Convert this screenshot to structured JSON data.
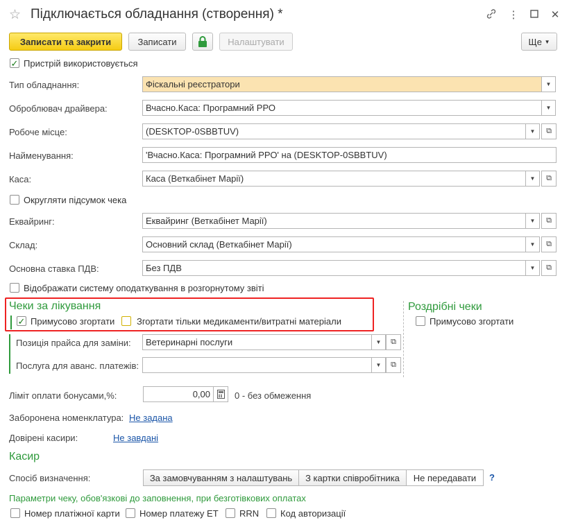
{
  "window": {
    "title": "Підключається обладнання (створення) *",
    "star_icon": "star-icon",
    "link_icon": "link-icon",
    "more_icon": "more-vert-icon",
    "maximize_icon": "maximize-icon",
    "close_icon": "close-icon"
  },
  "toolbar": {
    "save_close_label": "Записати та закрити",
    "save_label": "Записати",
    "lock_icon": "lock-icon",
    "settings_label": "Налаштувати",
    "more_label": "Ще"
  },
  "device_used": {
    "label": "Пристрій використовується",
    "checked": true
  },
  "fields": {
    "equipment_type": {
      "label": "Тип обладнання:",
      "value": "Фіскальні реєстратори"
    },
    "driver_handler": {
      "label": "Оброблювач драйвера:",
      "value": "Вчасно.Каса: Програмний РРО"
    },
    "workplace": {
      "label": "Робоче місце:",
      "value": "(DESKTOP-0SBBTUV)"
    },
    "name": {
      "label": "Найменування:",
      "value": "'Вчасно.Каса: Програмний РРО' на (DESKTOP-0SBBTUV)"
    },
    "cash_desk": {
      "label": "Каса:",
      "value": "Каса (Веткабінет Марії)"
    },
    "acquiring": {
      "label": "Еквайринг:",
      "value": "Еквайринг (Веткабінет Марії)"
    },
    "warehouse": {
      "label": "Склад:",
      "value": "Основний склад (Веткабінет Марії)"
    },
    "vat_rate": {
      "label": "Основна ставка ПДВ:",
      "value": "Без ПДВ"
    }
  },
  "round_total": {
    "label": "Округляти підсумок чека",
    "checked": false
  },
  "show_tax_system": {
    "label": "Відображати систему оподаткування в розгорнутому звіті",
    "checked": false
  },
  "treatment_receipts": {
    "title": "Чеки за лікування",
    "force_collapse": {
      "label": "Примусово згортати",
      "checked": true
    },
    "collapse_only_meds": {
      "label": "Згортати тільки медикаменти/витратні матеріали",
      "checked": false
    },
    "price_position": {
      "label": "Позиція прайса для заміни:",
      "value": "Ветеринарні послуги"
    },
    "advance_service": {
      "label": "Послуга для аванс. платежів:",
      "value": ""
    }
  },
  "retail_receipts": {
    "title": "Роздрібні чеки",
    "force_collapse": {
      "label": "Примусово згортати",
      "checked": false
    }
  },
  "bonus_limit": {
    "label": "Ліміт оплати бонусами,%:",
    "value": "0,00",
    "hint": "0 - без обмеження",
    "calc_icon": "calculator-icon"
  },
  "forbidden_nomenclature": {
    "label": "Заборонена номенклатура:",
    "link": "Не задана"
  },
  "trusted_cashiers": {
    "label": "Довірені касири:",
    "link": "Не завдані"
  },
  "cashier": {
    "title": "Касир",
    "method_label": "Спосіб визначення:",
    "options": [
      "За замовчуванням з налаштувань",
      "З картки співробітника",
      "Не передавати"
    ],
    "selected": "Не передавати",
    "help": "?"
  },
  "receipt_params": {
    "title": "Параметри чеку, обов'язкові до заповнення, при безготівкових оплатах",
    "options": [
      {
        "label": "Номер платіжної карти",
        "checked": false
      },
      {
        "label": "Номер платежу ЕТ",
        "checked": false
      },
      {
        "label": "RRN",
        "checked": false
      },
      {
        "label": "Код авторизації",
        "checked": false
      }
    ]
  },
  "colors": {
    "accent_green": "#2f9a3c",
    "primary_yellow": "#f5cc14",
    "highlight_red": "#e22222",
    "link_blue": "#1a55a8"
  }
}
